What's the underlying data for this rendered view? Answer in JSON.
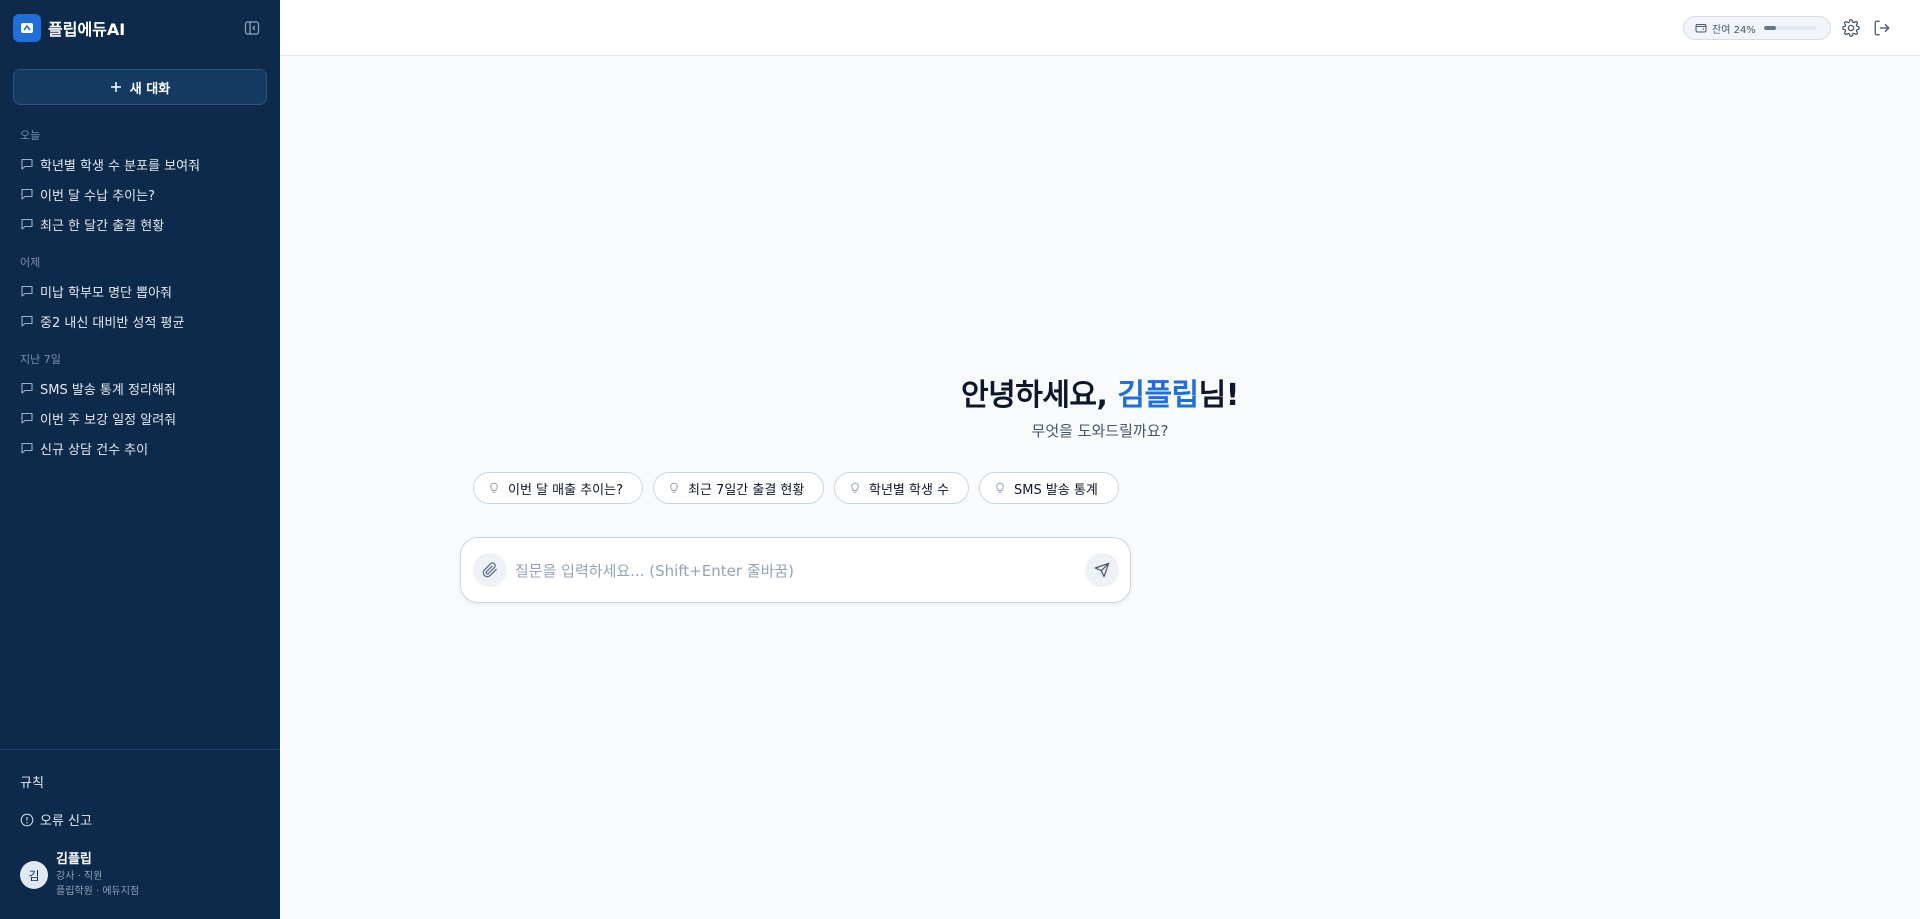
{
  "sidebar": {
    "brand": "플립에듀AI",
    "new_chat": "새 대화",
    "sections": [
      {
        "label": "오늘",
        "items": [
          "학년별 학생 수 분포를 보여줘",
          "이번 달 수납 추이는?",
          "최근 한 달간 출결 현황"
        ]
      },
      {
        "label": "어제",
        "items": [
          "미납 학부모 명단 뽑아줘",
          "중2 내신 대비반 성적 평균"
        ]
      },
      {
        "label": "지난 7일",
        "items": [
          "SMS 발송 통계 정리해줘",
          "이번 주 보강 일정 알려줘",
          "신규 상담 건수 추이"
        ]
      }
    ],
    "rules": "규칙",
    "report": "오류 신고",
    "user": {
      "initial": "김",
      "name": "김플립",
      "role": "강사 · 직원",
      "org": "플립학원 · 에듀지점"
    }
  },
  "topbar": {
    "usage_label": "잔여 24%",
    "usage_percent": 24
  },
  "main": {
    "greeting_prefix": "안녕하세요, ",
    "greeting_name": "김플립",
    "greeting_suffix": "님!",
    "subtitle": "무엇을 도와드릴까요?",
    "suggestions": [
      "이번 달 매출 추이는?",
      "최근 7일간 출결 현황",
      "학년별 학생 수",
      "SMS 발송 통계"
    ],
    "input_placeholder": "질문을 입력하세요... (Shift+Enter 줄바꿈)"
  },
  "colors": {
    "sidebar_bg": "#0e2a4a",
    "accent": "#1e6fd9"
  }
}
